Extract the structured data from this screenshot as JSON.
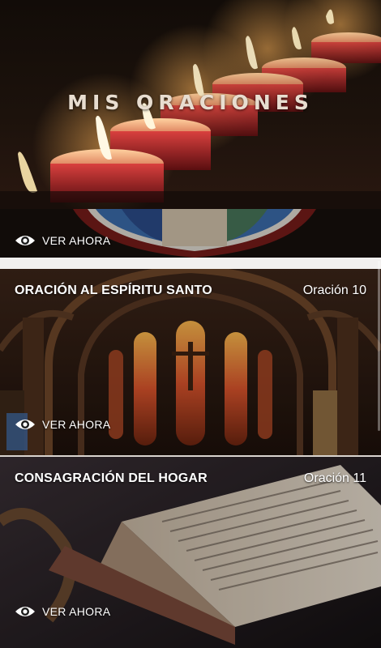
{
  "header": {
    "title": "MIS ORACIONES"
  },
  "cards": [
    {
      "title": "",
      "number": "",
      "view_label": "VER AHORA",
      "eye_icon": "eye-icon"
    },
    {
      "title": "ORACIÓN AL ESPÍRITU SANTO",
      "number": "Oración 10",
      "view_label": "VER AHORA",
      "eye_icon": "eye-icon"
    },
    {
      "title": "CONSAGRACIÓN DEL HOGAR",
      "number": "Oración 11",
      "view_label": "VER AHORA",
      "eye_icon": "eye-icon"
    }
  ],
  "colors": {
    "hero_bg": "#1c120c",
    "candle_cup": "#b3262a",
    "flame": "#ffe9b0",
    "title_text": "#e8ddd0",
    "divider": "#f2f0ef",
    "text": "#ffffff"
  }
}
